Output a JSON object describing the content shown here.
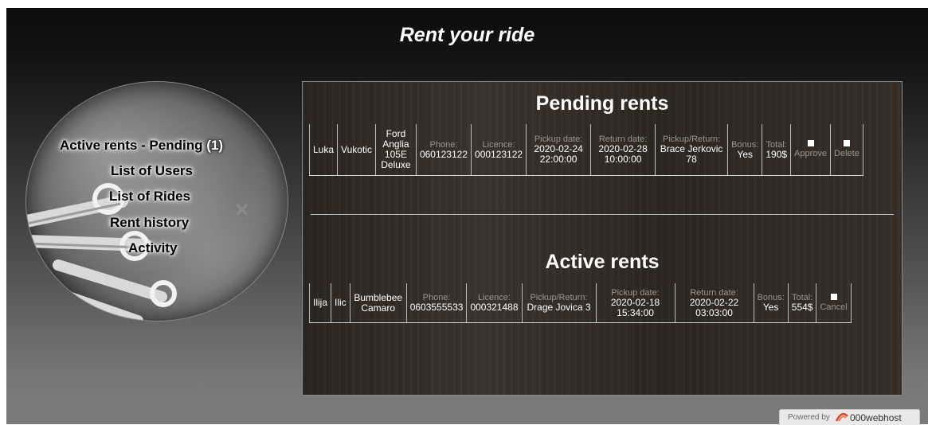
{
  "site": {
    "title": "Rent your ride"
  },
  "menu": {
    "items": [
      {
        "label": "Active rents - Pending",
        "count": "(1)"
      },
      {
        "label": "List of Users"
      },
      {
        "label": "List of Rides"
      },
      {
        "label": "Rent history"
      },
      {
        "label": "Activity"
      }
    ]
  },
  "pending": {
    "title": "Pending rents",
    "labels": {
      "phone": "Phone:",
      "licence": "Licence:",
      "pickup_date": "Pickup date:",
      "return_date": "Return date:",
      "pickup_return": "Pickup/Return:",
      "bonus": "Bonus:",
      "total": "Total:"
    },
    "row": {
      "first_name": "Luka",
      "last_name": "Vukotic",
      "vehicle": "Ford Anglia 105E Deluxe",
      "phone": "060123122",
      "licence": "000123122",
      "pickup_date": "2020-02-24 22:00:00",
      "return_date": "2020-02-28 10:00:00",
      "pickup_return": "Brace Jerkovic 78",
      "bonus": "Yes",
      "total": "190$",
      "approve_label": "Approve",
      "delete_label": "Delete"
    }
  },
  "active": {
    "title": "Active rents",
    "labels": {
      "phone": "Phone:",
      "licence": "Licence:",
      "pickup_return": "Pickup/Return:",
      "pickup_date": "Pickup date:",
      "return_date": "Return date:",
      "bonus": "Bonus:",
      "total": "Total:"
    },
    "row": {
      "first_name": "Ilija",
      "last_name": "Ilic",
      "vehicle": "Bumblebee Camaro",
      "phone": "0603555533",
      "licence": "000321488",
      "pickup_return": "Drage Jovica 3",
      "pickup_date": "2020-02-18 15:34:00",
      "return_date": "2020-02-22 03:03:00",
      "bonus": "Yes",
      "total": "554$",
      "cancel_label": "Cancel"
    }
  },
  "footer": {
    "powered_by": "Powered by",
    "host": "000webhost"
  },
  "colors": {
    "label_grey": "#9a9590",
    "panel_wood": "#3a322c",
    "text_white": "#ffffff"
  }
}
